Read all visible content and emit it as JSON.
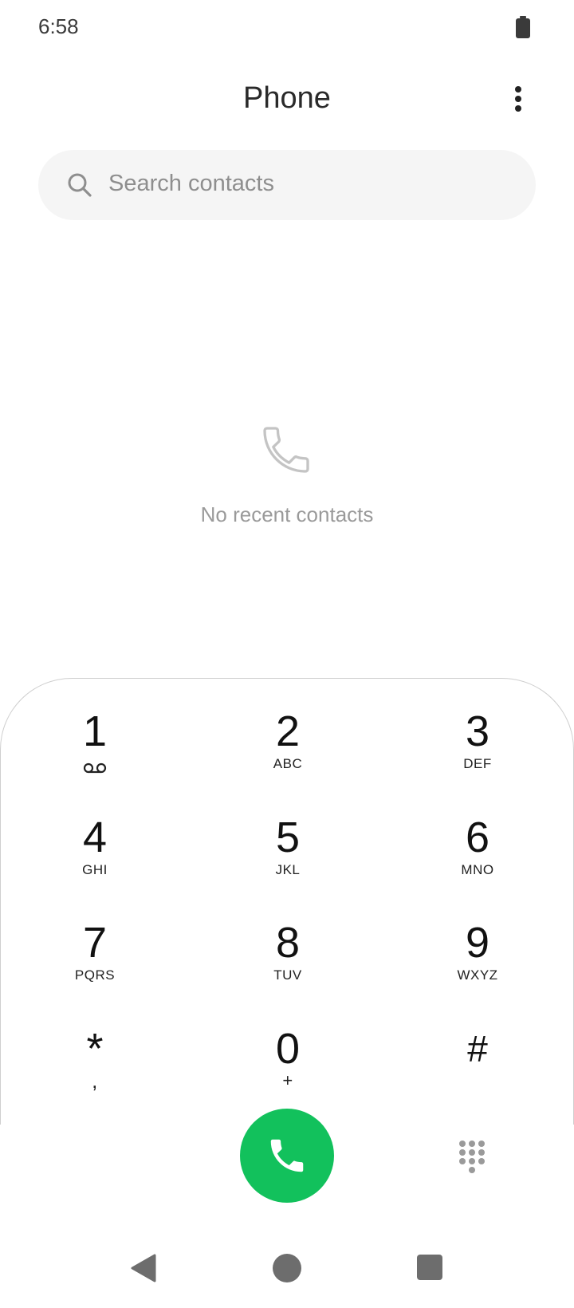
{
  "status_bar": {
    "time": "6:58"
  },
  "header": {
    "title": "Phone"
  },
  "search": {
    "placeholder": "Search contacts"
  },
  "empty_state": {
    "message": "No recent contacts"
  },
  "dialpad": {
    "keys": [
      {
        "digit": "1",
        "letters": ""
      },
      {
        "digit": "2",
        "letters": "ABC"
      },
      {
        "digit": "3",
        "letters": "DEF"
      },
      {
        "digit": "4",
        "letters": "GHI"
      },
      {
        "digit": "5",
        "letters": "JKL"
      },
      {
        "digit": "6",
        "letters": "MNO"
      },
      {
        "digit": "7",
        "letters": "PQRS"
      },
      {
        "digit": "8",
        "letters": "TUV"
      },
      {
        "digit": "9",
        "letters": "WXYZ"
      },
      {
        "digit": "*",
        "letters": ","
      },
      {
        "digit": "0",
        "letters": "+"
      },
      {
        "digit": "#",
        "letters": ""
      }
    ]
  },
  "colors": {
    "call_button": "#12c15c",
    "nav": "#6d6d6d"
  },
  "icons": {
    "battery": "battery-icon",
    "menu": "more-vert-icon",
    "search": "search-icon",
    "empty": "phone-outline-icon",
    "voicemail": "voicemail-icon",
    "call": "phone-call-icon",
    "dialpad_toggle": "dialpad-icon"
  }
}
